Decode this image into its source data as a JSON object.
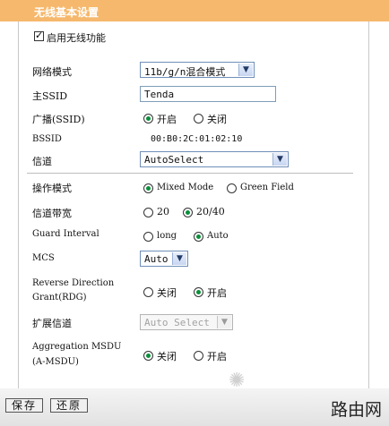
{
  "header": {
    "title": "无线基本设置"
  },
  "enable_wireless": {
    "label": "启用无线功能",
    "checked": true
  },
  "network_mode": {
    "label": "网络模式",
    "value": "11b/g/n混合模式"
  },
  "ssid": {
    "label": "主SSID",
    "value": "Tenda"
  },
  "broadcast": {
    "label": "广播(SSID)",
    "options": [
      "开启",
      "关闭"
    ],
    "selected": "开启"
  },
  "bssid": {
    "label": "BSSID",
    "value": "00:B0:2C:01:02:10"
  },
  "channel": {
    "label": "信道",
    "value": "AutoSelect"
  },
  "operation_mode": {
    "label": "操作模式",
    "options": [
      "Mixed Mode",
      "Green Field"
    ],
    "selected": "Mixed Mode"
  },
  "bandwidth": {
    "label": "信道带宽",
    "options": [
      "20",
      "20/40"
    ],
    "selected": "20/40"
  },
  "guard_interval": {
    "label": "Guard Interval",
    "options": [
      "long",
      "Auto"
    ],
    "selected": "Auto"
  },
  "mcs": {
    "label": "MCS",
    "value": "Auto"
  },
  "rdg": {
    "label_line1": "Reverse Direction",
    "label_line2": "Grant(RDG)",
    "options": [
      "关闭",
      "开启"
    ],
    "selected": "开启"
  },
  "ext_channel": {
    "label": "扩展信道",
    "value": "Auto Select"
  },
  "amsdu": {
    "label_line1": "Aggregation MSDU",
    "label_line2": "(A-MSDU)",
    "options": [
      "关闭",
      "开启"
    ],
    "selected": "关闭"
  },
  "buttons": {
    "save": "保存",
    "restore": "还原"
  },
  "watermark": {
    "text": "路由网"
  }
}
